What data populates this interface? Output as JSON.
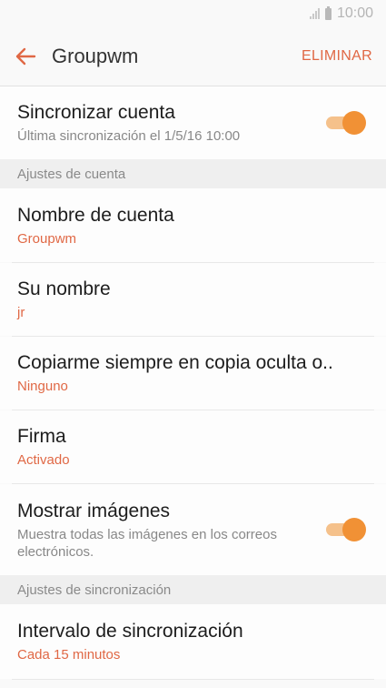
{
  "status_bar": {
    "time": "10:00"
  },
  "header": {
    "title": "Groupwm",
    "action_label": "ELIMINAR"
  },
  "sync_account": {
    "title": "Sincronizar cuenta",
    "subtitle": "Última sincronización el 1/5/16 10:00",
    "enabled": true
  },
  "sections": {
    "account_settings": "Ajustes de cuenta",
    "sync_settings": "Ajustes de sincronización"
  },
  "items": {
    "account_name": {
      "title": "Nombre de cuenta",
      "value": "Groupwm"
    },
    "your_name": {
      "title": "Su nombre",
      "value": "jr"
    },
    "bcc": {
      "title": "Copiarme siempre en copia oculta o..",
      "value": "Ninguno"
    },
    "signature": {
      "title": "Firma",
      "value": "Activado"
    },
    "show_images": {
      "title": "Mostrar imágenes",
      "subtitle": "Muestra todas las imágenes en los correos electrónicos.",
      "enabled": true
    },
    "sync_interval": {
      "title": "Intervalo de sincronización",
      "value": "Cada 15 minutos"
    }
  },
  "colors": {
    "accent": "#e06845",
    "toggle_knob": "#f19135",
    "toggle_track": "#f5c18b"
  }
}
